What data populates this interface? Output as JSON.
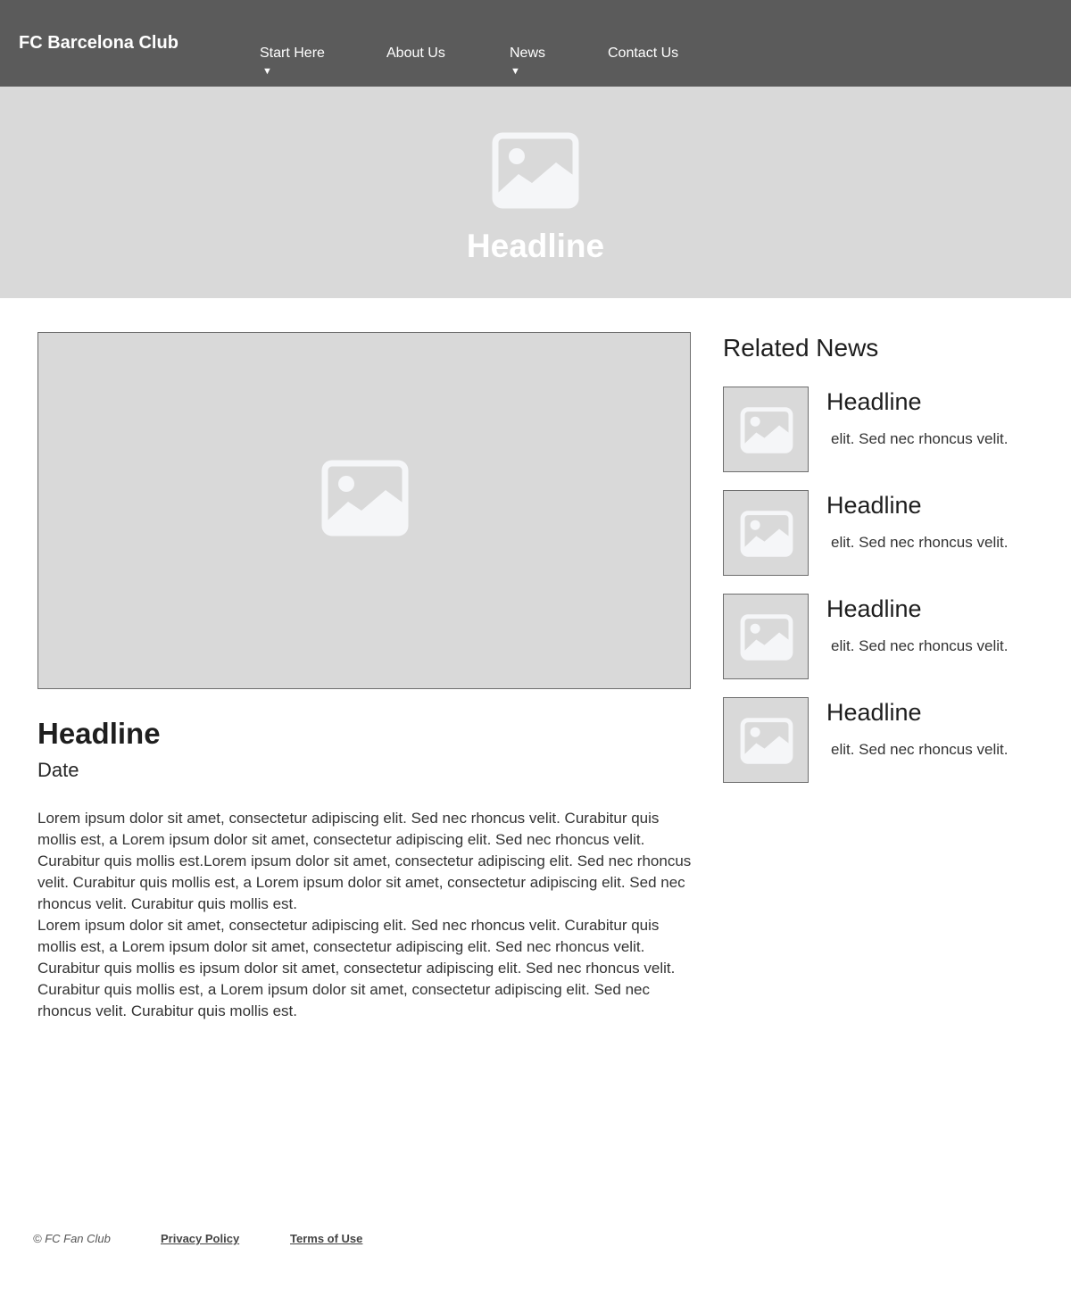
{
  "header": {
    "logo": "FC Barcelona Club",
    "nav": [
      {
        "label": "Start Here",
        "has_dropdown": true,
        "caret": "▼"
      },
      {
        "label": "About Us",
        "has_dropdown": false
      },
      {
        "label": "News",
        "has_dropdown": true,
        "caret": "▼"
      },
      {
        "label": "Contact Us",
        "has_dropdown": false
      }
    ],
    "background_color": "#5b5b5b"
  },
  "hero": {
    "icon": "image-placeholder-icon",
    "title": "Headline",
    "background_color": "#d9d9d9"
  },
  "article": {
    "image_icon": "image-placeholder-icon",
    "title": "Headline",
    "date": "Date",
    "paragraphs": [
      "Lorem ipsum dolor sit amet, consectetur adipiscing elit. Sed nec rhoncus velit. Curabitur quis mollis est, a Lorem ipsum dolor sit amet, consectetur adipiscing elit. Sed nec rhoncus velit. Curabitur quis mollis est.Lorem ipsum dolor sit amet, consectetur adipiscing elit. Sed nec rhoncus velit. Curabitur quis mollis est, a Lorem ipsum dolor sit amet, consectetur adipiscing elit. Sed nec rhoncus velit. Curabitur quis mollis est.",
      "Lorem ipsum dolor sit amet, consectetur adipiscing elit. Sed nec rhoncus velit. Curabitur quis mollis est, a Lorem ipsum dolor sit amet, consectetur adipiscing elit. Sed nec rhoncus velit. Curabitur quis mollis es  ipsum dolor sit amet, consectetur adipiscing elit. Sed nec rhoncus velit. Curabitur quis mollis est, a Lorem ipsum dolor sit amet, consectetur adipiscing elit. Sed nec rhoncus velit. Curabitur quis mollis est."
    ]
  },
  "sidebar": {
    "title": "Related News",
    "items": [
      {
        "headline": "Headline",
        "text": "elit. Sed nec rhoncus velit.",
        "icon": "image-placeholder-icon"
      },
      {
        "headline": "Headline",
        "text": "elit. Sed nec rhoncus velit.",
        "icon": "image-placeholder-icon"
      },
      {
        "headline": "Headline",
        "text": "elit. Sed nec rhoncus velit.",
        "icon": "image-placeholder-icon"
      },
      {
        "headline": "Headline",
        "text": "elit. Sed nec rhoncus velit.",
        "icon": "image-placeholder-icon"
      }
    ]
  },
  "footer": {
    "copyright": "© FC Fan Club",
    "links": [
      "Privacy Policy",
      "Terms of Use"
    ]
  }
}
